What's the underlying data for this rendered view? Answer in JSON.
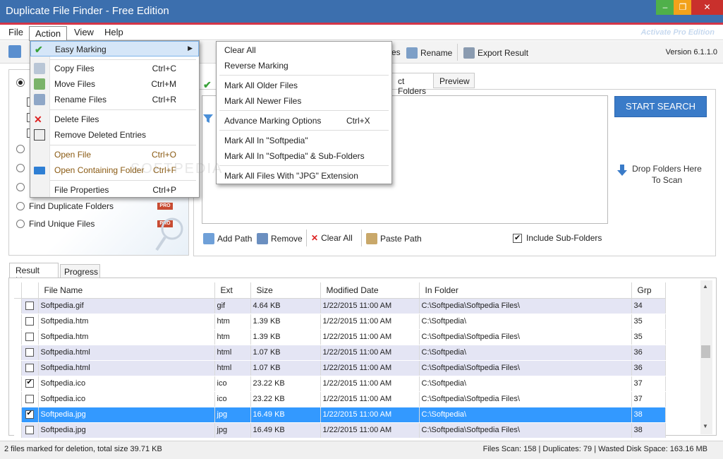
{
  "window": {
    "title": "Duplicate File Finder - Free Edition",
    "min": "–",
    "max": "❐",
    "close": "✕"
  },
  "menubar": {
    "file": "File",
    "action": "Action",
    "view": "View",
    "help": "Help",
    "activate": "Activate Pro Edition"
  },
  "toolbar": {
    "rename": "Rename",
    "export": "Export Result",
    "files_partial": "es",
    "version": "Version 6.1.1.0"
  },
  "search_options": {
    "find_duplicate_folders": "Find Duplicate Folders",
    "find_unique_files": "Find Unique Files",
    "pro": "PRO"
  },
  "tabs": {
    "folders_partial": "ct Folders",
    "preview": "Preview"
  },
  "start_search": "START SEARCH",
  "drop_hint": "Drop Folders Here To Scan",
  "path_buttons": {
    "add": "Add Path",
    "remove": "Remove",
    "clear": "Clear All",
    "paste": "Paste Path",
    "include_sub": "Include Sub-Folders"
  },
  "result_tabs": {
    "result": "Result List",
    "progress": "Progress"
  },
  "grid": {
    "headers": [
      "File Name",
      "Ext",
      "Size",
      "Modified Date",
      "In Folder",
      "Grp"
    ],
    "rows": [
      {
        "name": "Softpedia.gif",
        "ext": "gif",
        "size": "4.64 KB",
        "date": "1/22/2015 11:00 AM",
        "folder": "C:\\Softpedia\\Softpedia Files\\",
        "grp": "34",
        "checked": false,
        "style": "alt"
      },
      {
        "name": "Softpedia.htm",
        "ext": "htm",
        "size": "1.39 KB",
        "date": "1/22/2015 11:00 AM",
        "folder": "C:\\Softpedia\\",
        "grp": "35",
        "checked": false,
        "style": "r"
      },
      {
        "name": "Softpedia.htm",
        "ext": "htm",
        "size": "1.39 KB",
        "date": "1/22/2015 11:00 AM",
        "folder": "C:\\Softpedia\\Softpedia Files\\",
        "grp": "35",
        "checked": false,
        "style": "r"
      },
      {
        "name": "Softpedia.html",
        "ext": "html",
        "size": "1.07 KB",
        "date": "1/22/2015 11:00 AM",
        "folder": "C:\\Softpedia\\",
        "grp": "36",
        "checked": false,
        "style": "alt"
      },
      {
        "name": "Softpedia.html",
        "ext": "html",
        "size": "1.07 KB",
        "date": "1/22/2015 11:00 AM",
        "folder": "C:\\Softpedia\\Softpedia Files\\",
        "grp": "36",
        "checked": false,
        "style": "alt"
      },
      {
        "name": "Softpedia.ico",
        "ext": "ico",
        "size": "23.22 KB",
        "date": "1/22/2015 11:00 AM",
        "folder": "C:\\Softpedia\\",
        "grp": "37",
        "checked": true,
        "style": "r"
      },
      {
        "name": "Softpedia.ico",
        "ext": "ico",
        "size": "23.22 KB",
        "date": "1/22/2015 11:00 AM",
        "folder": "C:\\Softpedia\\Softpedia Files\\",
        "grp": "37",
        "checked": false,
        "style": "r"
      },
      {
        "name": "Softpedia.jpg",
        "ext": "jpg",
        "size": "16.49 KB",
        "date": "1/22/2015 11:00 AM",
        "folder": "C:\\Softpedia\\",
        "grp": "38",
        "checked": true,
        "style": "sel"
      },
      {
        "name": "Softpedia.jpg",
        "ext": "jpg",
        "size": "16.49 KB",
        "date": "1/22/2015 11:00 AM",
        "folder": "C:\\Softpedia\\Softpedia Files\\",
        "grp": "38",
        "checked": false,
        "style": "alt"
      }
    ]
  },
  "status": {
    "left": "2 files marked for deletion, total size 39.71 KB",
    "right": "Files Scan: 158 | Duplicates: 79 | Wasted Disk Space: 163.16 MB"
  },
  "action_menu": {
    "easy_marking": "Easy Marking",
    "copy": {
      "label": "Copy Files",
      "shortcut": "Ctrl+C"
    },
    "move": {
      "label": "Move Files",
      "shortcut": "Ctrl+M"
    },
    "rename": {
      "label": "Rename Files",
      "shortcut": "Ctrl+R"
    },
    "delete": {
      "label": "Delete Files"
    },
    "remove_deleted": {
      "label": "Remove Deleted Entries"
    },
    "open_file": {
      "label": "Open File",
      "shortcut": "Ctrl+O"
    },
    "open_folder": {
      "label": "Open Containing Folder",
      "shortcut": "Ctrl+F"
    },
    "properties": {
      "label": "File Properties",
      "shortcut": "Ctrl+P"
    }
  },
  "submenu": {
    "clear_all": "Clear All",
    "reverse": "Reverse Marking",
    "older": "Mark All Older Files",
    "newer": "Mark All Newer Files",
    "advance": {
      "label": "Advance Marking Options",
      "shortcut": "Ctrl+X"
    },
    "in_softpedia": "Mark All In \"Softpedia\"",
    "in_softpedia_sub": "Mark All In \"Softpedia\" & Sub-Folders",
    "jpg_ext": "Mark All Files With \"JPG\" Extension"
  },
  "watermark": "SOFTPEDIA"
}
